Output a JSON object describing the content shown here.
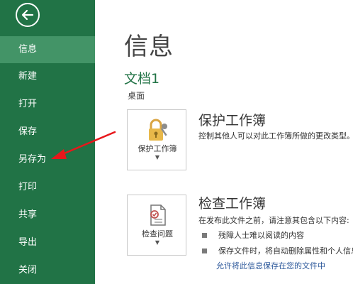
{
  "sidebar": {
    "items": [
      {
        "label": "信息",
        "active": true
      },
      {
        "label": "新建"
      },
      {
        "label": "打开"
      },
      {
        "label": "保存"
      },
      {
        "label": "另存为"
      },
      {
        "label": "打印"
      },
      {
        "label": "共享"
      },
      {
        "label": "导出"
      },
      {
        "label": "关闭"
      }
    ]
  },
  "main": {
    "title": "信息",
    "doc_name": "文档1",
    "doc_location": "桌面",
    "protect": {
      "tile_label": "保护工作簿",
      "heading": "保护工作簿",
      "desc": "控制其他人可以对此工作簿所做的更改类型。"
    },
    "inspect": {
      "tile_label": "检查问题",
      "heading": "检查工作簿",
      "desc": "在发布此文件之前，请注意其包含以下内容:",
      "bullets": [
        "残障人士难以阅读的内容",
        "保存文件时，将自动删除属性和个人信息"
      ],
      "link": "允许将此信息保存在您的文件中"
    }
  },
  "colors": {
    "sidebar_bg": "#217346",
    "sidebar_active": "#439467",
    "accent_green": "#217346",
    "link_blue": "#2b579a",
    "annotation_red": "#e8171b"
  }
}
